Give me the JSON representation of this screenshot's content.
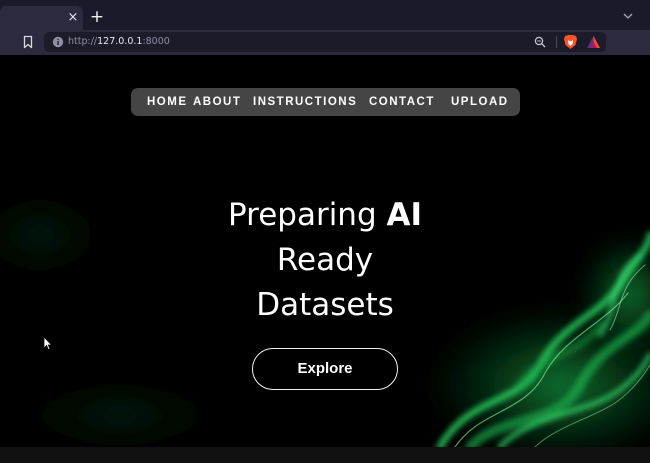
{
  "browser": {
    "tab": {
      "close_glyph": "×"
    },
    "new_tab_glyph": "+",
    "url": {
      "scheme": "http://",
      "host": "127.0.0.1",
      "port": ":8000"
    },
    "icons": {
      "bookmark": "bookmark-icon",
      "site_info": "info-icon",
      "zoom": "zoom-icon",
      "brave": "brave-lion-icon",
      "rewards": "brave-rewards-icon",
      "tab_list": "chevron-down-icon"
    }
  },
  "nav": {
    "items": [
      {
        "label": "HOME"
      },
      {
        "label": "ABOUT"
      },
      {
        "label": "INSTRUCTIONS"
      },
      {
        "label": "CONTACT"
      },
      {
        "label": "UPLOAD"
      }
    ]
  },
  "hero": {
    "title_plain": "Preparing ",
    "title_strong": "AI",
    "title_line2": "Ready",
    "title_line3": "Datasets",
    "button_label": "Explore"
  },
  "colors": {
    "page_background": "#000000",
    "nav_background": "#454545",
    "smoke_accent": "#1fd85a",
    "browser_chrome": "#2b2a3f"
  }
}
